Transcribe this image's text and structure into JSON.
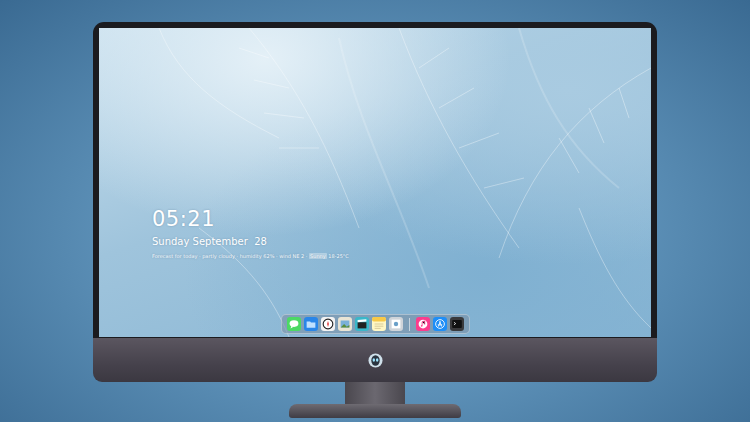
{
  "desktop": {
    "clock": {
      "time": "05:21",
      "date": "Sunday September  28",
      "info": {
        "before": "Forecast for today · partly cloudy · humidity 62% · wind NE 2 · ",
        "highlight": "Sunny",
        "after": " 18-25°C"
      }
    }
  }
}
